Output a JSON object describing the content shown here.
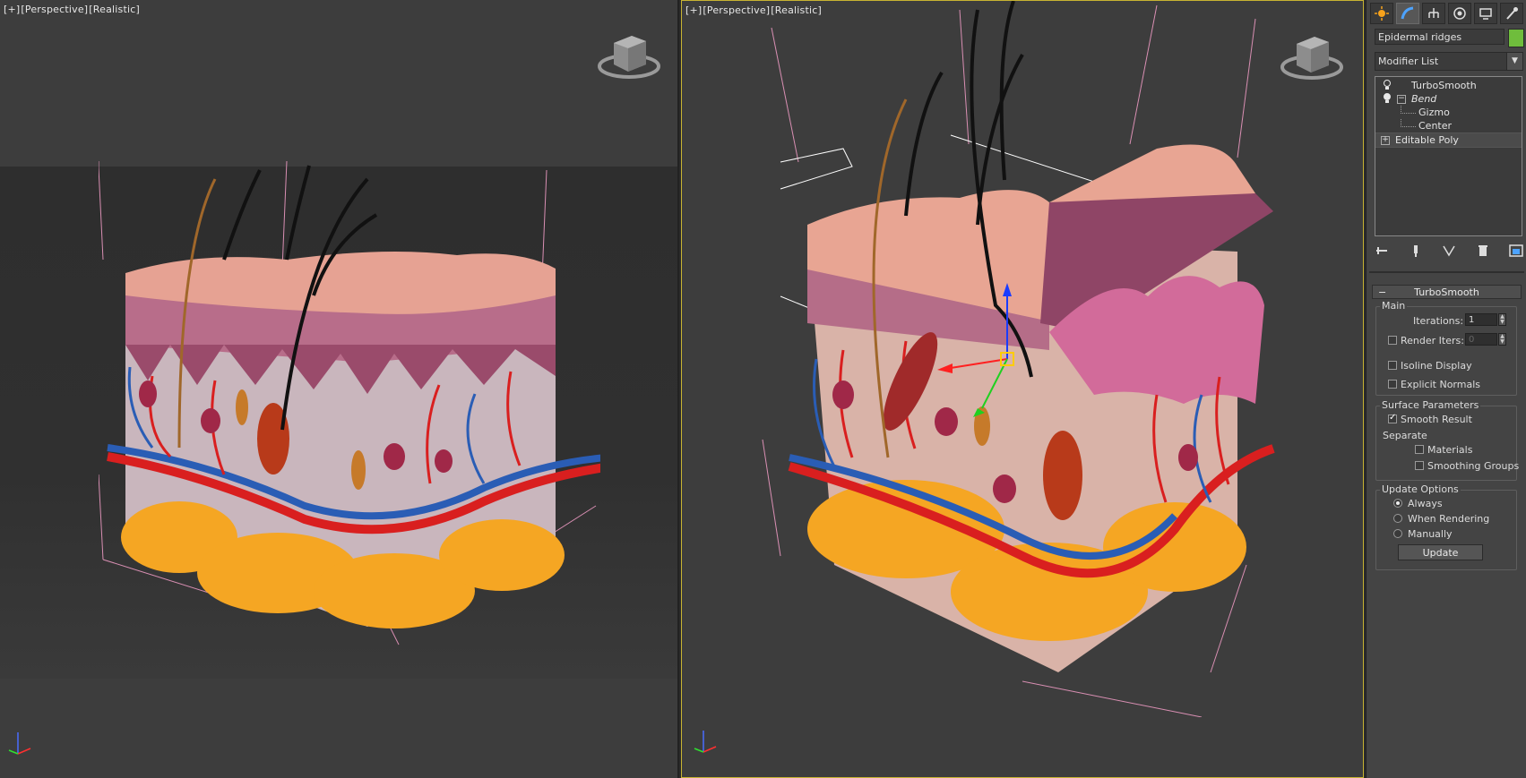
{
  "viewports": {
    "left": {
      "label_plus": "[+]",
      "label_view": "[Perspective]",
      "label_shading": "[Realistic]"
    },
    "right": {
      "label_plus": "[+]",
      "label_view": "[Perspective]",
      "label_shading": "[Realistic]"
    }
  },
  "command_panel": {
    "tabs": [
      "create-icon",
      "modify-icon",
      "hierarchy-icon",
      "motion-icon",
      "display-icon",
      "utilities-icon"
    ],
    "active_tab": "modify-icon",
    "object_name": "Epidermal ridges",
    "object_color": "#6fbd3c",
    "modifier_list": "Modifier List",
    "stack": {
      "turbosmooth": "TurboSmooth",
      "bend": "Bend",
      "gizmo": "Gizmo",
      "center": "Center",
      "editable_poly": "Editable Poly"
    }
  },
  "turbosmooth": {
    "header": "TurboSmooth",
    "main": {
      "title": "Main",
      "iterations_label": "Iterations:",
      "iterations_value": "1",
      "render_iters_label": "Render Iters:",
      "render_iters_value": "0",
      "isoline_label": "Isoline Display",
      "explicit_normals_label": "Explicit Normals"
    },
    "surface": {
      "title": "Surface Parameters",
      "smooth_result_label": "Smooth Result",
      "separate_label": "Separate",
      "materials_label": "Materials",
      "smoothing_groups_label": "Smoothing Groups"
    },
    "update": {
      "title": "Update Options",
      "always_label": "Always",
      "when_rendering_label": "When Rendering",
      "manually_label": "Manually",
      "update_button": "Update"
    }
  }
}
